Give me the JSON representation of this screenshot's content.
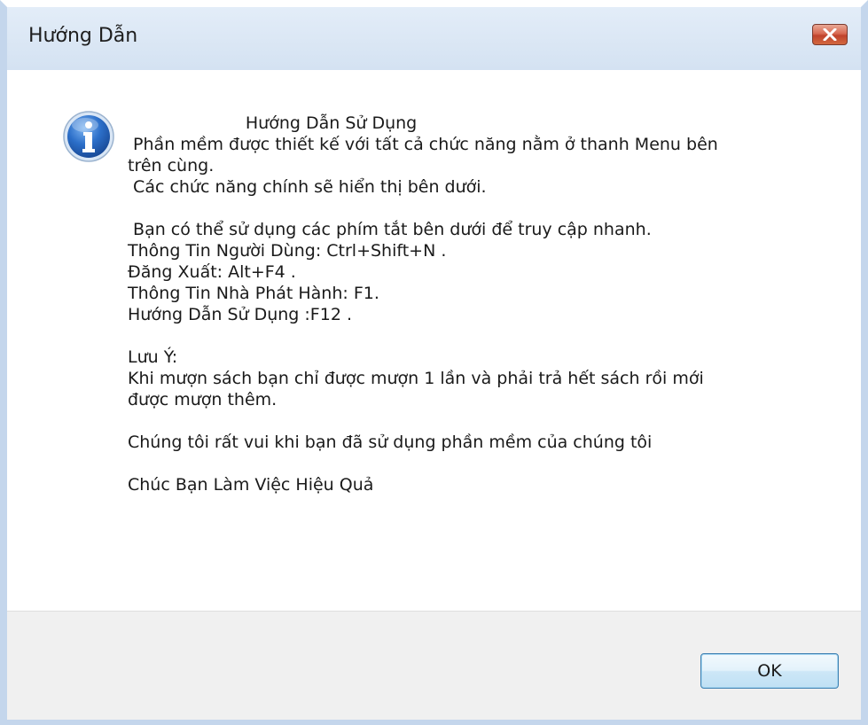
{
  "window": {
    "title": "Hướng Dẫn"
  },
  "icon": "information-icon",
  "message": {
    "text": "                      Hướng Dẫn Sử Dụng\n Phần mềm được thiết kế với tất cả chức năng nằm ở thanh Menu bên\ntrên cùng.\n Các chức năng chính sẽ hiển thị bên dưới.\n\n Bạn có thể sử dụng các phím tắt bên dưới để truy cập nhanh.\nThông Tin Người Dùng: Ctrl+Shift+N .\nĐăng Xuất: Alt+F4 .\nThông Tin Nhà Phát Hành: F1.\nHướng Dẫn Sử Dụng :F12 .\n\nLưu Ý:\nKhi mượn sách bạn chỉ được mượn 1 lần và phải trả hết sách rồi mới\nđược mượn thêm.\n\nChúng tôi rất vui khi bạn đã sử dụng phần mềm của chúng tôi\n\nChúc Bạn Làm Việc Hiệu Quả"
  },
  "buttons": {
    "ok_label": "OK"
  },
  "colors": {
    "close_button": "#c7472d",
    "ok_border": "#3c7fb1",
    "icon_blue": "#2c6fc9"
  }
}
